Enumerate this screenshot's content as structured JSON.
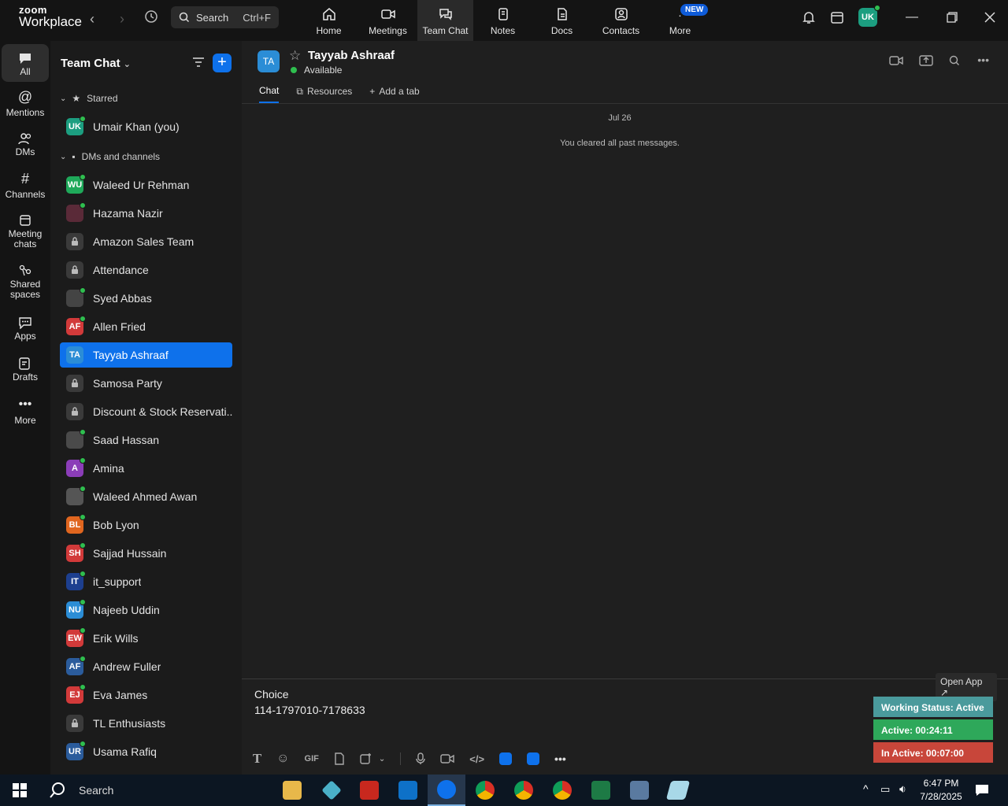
{
  "app": {
    "logo_line1": "zoom",
    "logo_line2": "Workplace"
  },
  "search": {
    "label": "Search",
    "shortcut": "Ctrl+F"
  },
  "top_tabs": [
    {
      "label": "Home",
      "icon": "home-icon"
    },
    {
      "label": "Meetings",
      "icon": "video-icon"
    },
    {
      "label": "Team Chat",
      "icon": "chat-icon",
      "active": true
    },
    {
      "label": "Notes",
      "icon": "notes-icon"
    },
    {
      "label": "Docs",
      "icon": "docs-icon"
    },
    {
      "label": "Contacts",
      "icon": "contacts-icon"
    },
    {
      "label": "More",
      "icon": "more-icon",
      "badge": "NEW"
    }
  ],
  "user": {
    "initials": "UK"
  },
  "rail": [
    {
      "label": "All"
    },
    {
      "label": "Mentions"
    },
    {
      "label": "DMs"
    },
    {
      "label": "Channels"
    },
    {
      "label": "Meeting chats"
    },
    {
      "label": "Shared spaces"
    },
    {
      "label": "Apps"
    },
    {
      "label": "Drafts"
    },
    {
      "label": "More"
    }
  ],
  "sidebar": {
    "title": "Team Chat",
    "starred_label": "Starred",
    "dms_label": "DMs and channels",
    "starred": [
      {
        "name": "Umair Khan (you)",
        "initials": "UK",
        "color": "#1c9e80"
      }
    ],
    "items": [
      {
        "name": "Waleed Ur Rehman",
        "initials": "WU",
        "color": "#1fa95a"
      },
      {
        "name": "Hazama Nazir",
        "initials": "",
        "color": "#5a2a38"
      },
      {
        "name": "Amazon Sales Team",
        "initials": "",
        "color": "#3a3a3a",
        "lock": true
      },
      {
        "name": "Attendance",
        "initials": "",
        "color": "#3a3a3a",
        "lock": true
      },
      {
        "name": "Syed Abbas",
        "initials": "",
        "color": "#444444"
      },
      {
        "name": "Allen Fried",
        "initials": "AF",
        "color": "#d23a3a"
      },
      {
        "name": "Tayyab Ashraaf",
        "initials": "TA",
        "color": "#0e71eb",
        "selected": true
      },
      {
        "name": "Samosa Party",
        "initials": "",
        "color": "#3a3a3a",
        "lock": true
      },
      {
        "name": "Discount & Stock Reservati...",
        "initials": "",
        "color": "#3a3a3a",
        "lock": true
      },
      {
        "name": "Saad Hassan",
        "initials": "",
        "color": "#4a4a4a"
      },
      {
        "name": "Amina",
        "initials": "A",
        "color": "#8b3db8"
      },
      {
        "name": "Waleed Ahmed Awan",
        "initials": "",
        "color": "#555555"
      },
      {
        "name": "Bob Lyon",
        "initials": "BL",
        "color": "#e0661f"
      },
      {
        "name": "Sajjad Hussain",
        "initials": "SH",
        "color": "#d23a3a"
      },
      {
        "name": "it_support",
        "initials": "IT",
        "color": "#1d3f8f"
      },
      {
        "name": "Najeeb Uddin",
        "initials": "NU",
        "color": "#2b8dd6"
      },
      {
        "name": "Erik Wills",
        "initials": "EW",
        "color": "#d23a3a"
      },
      {
        "name": "Andrew Fuller",
        "initials": "AF",
        "color": "#2b5c9c"
      },
      {
        "name": "Eva James",
        "initials": "EJ",
        "color": "#d23a3a"
      },
      {
        "name": "TL Enthusiasts",
        "initials": "",
        "color": "#3a3a3a",
        "lock": true
      },
      {
        "name": "Usama Rafiq",
        "initials": "UR",
        "color": "#2b5c9c"
      }
    ]
  },
  "chat": {
    "contact_initials": "TA",
    "contact_name": "Tayyab Ashraaf",
    "status": "Available",
    "tabs": [
      "Chat",
      "Resources",
      "Add a tab"
    ],
    "date": "Jul 26",
    "system_message": "You cleared all past messages.",
    "composer_line1": "Choice",
    "composer_line2": "114-1797010-7178633",
    "gif_label": "GIF"
  },
  "widget": {
    "open_app": "Open App ↗",
    "working_status": "Working Status: Active",
    "active": "Active: 00:24:11",
    "inactive": "In Active: 00:07:00",
    "colors": {
      "working": "#4a9a9c",
      "active": "#2ea85a",
      "inactive": "#c8463a"
    }
  },
  "taskbar": {
    "search": "Search",
    "time": "6:47 PM",
    "date": "7/28/2025"
  }
}
